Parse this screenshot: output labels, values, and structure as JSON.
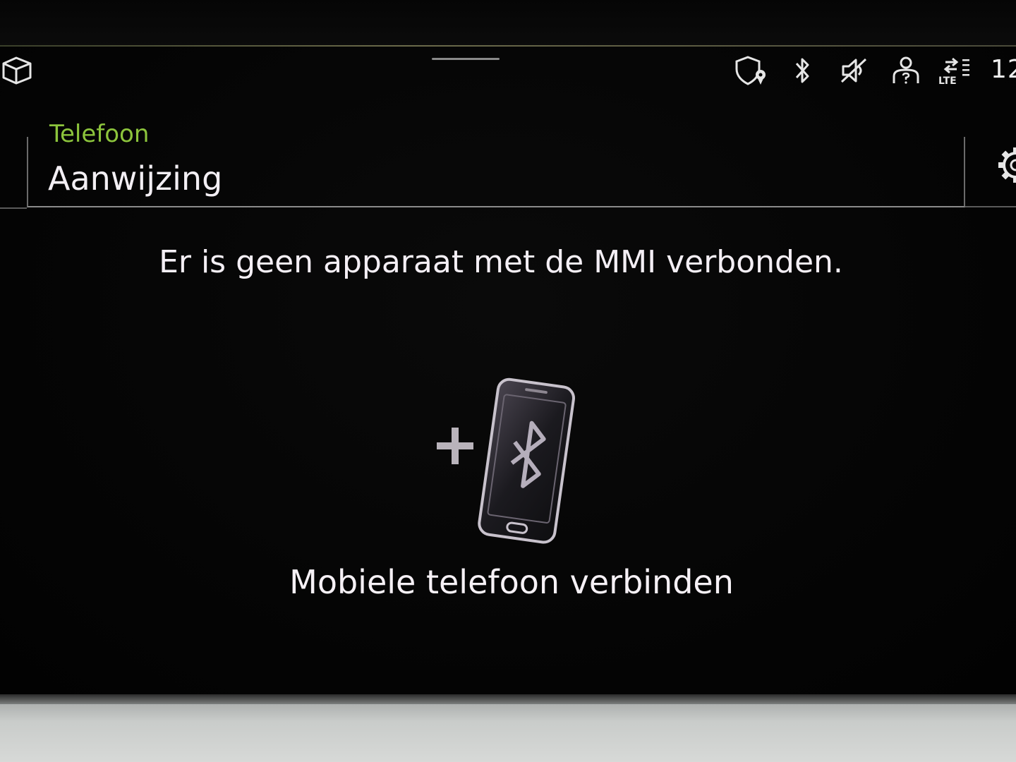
{
  "status_bar": {
    "icons": [
      "3d-cube-icon",
      "shield-location-icon",
      "bluetooth-icon",
      "mute-icon",
      "user-icon",
      "lte-signal-icon",
      "settings-gear-icon"
    ],
    "lte_label": "LTE",
    "clock": "12"
  },
  "header": {
    "breadcrumb": "Telefoon",
    "title": "Aanwijzing"
  },
  "main": {
    "message": "Er is geen apparaat met de MMI verbonden.",
    "connect_label": "Mobiele telefoon verbinden"
  },
  "colors": {
    "accent_green": "#8cc43c",
    "text": "#f1eef2",
    "background": "#000000"
  }
}
